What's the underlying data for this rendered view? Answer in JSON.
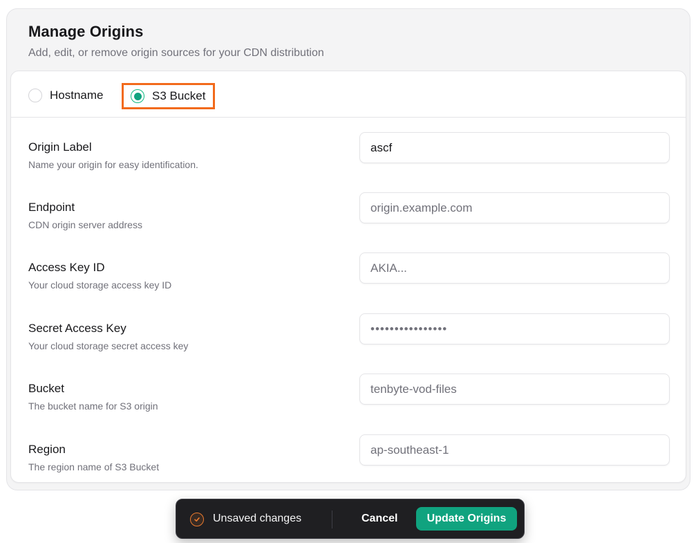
{
  "header": {
    "title": "Manage Origins",
    "subtitle": "Add, edit, or remove origin sources for your CDN distribution"
  },
  "origin_type": {
    "options": [
      {
        "label": "Hostname",
        "selected": false
      },
      {
        "label": "S3 Bucket",
        "selected": true
      }
    ]
  },
  "fields": {
    "origin_label": {
      "label": "Origin Label",
      "help": "Name your origin for easy identification.",
      "value": "ascf",
      "placeholder": ""
    },
    "endpoint": {
      "label": "Endpoint",
      "help": "CDN origin server address",
      "value": "",
      "placeholder": "origin.example.com"
    },
    "access_key_id": {
      "label": "Access Key ID",
      "help": "Your cloud storage access key ID",
      "value": "",
      "placeholder": "AKIA..."
    },
    "secret_access_key": {
      "label": "Secret Access Key",
      "help": "Your cloud storage secret access key",
      "value": "",
      "placeholder": "••••••••••••••••"
    },
    "bucket": {
      "label": "Bucket",
      "help": "The bucket name for S3 origin",
      "value": "",
      "placeholder": "tenbyte-vod-files"
    },
    "region": {
      "label": "Region",
      "help": "The region name of S3 Bucket",
      "value": "",
      "placeholder": "ap-southeast-1"
    }
  },
  "toast": {
    "icon": "warning-check-icon",
    "message": "Unsaved changes",
    "cancel_label": "Cancel",
    "update_label": "Update Origins"
  },
  "colors": {
    "accent": "#10a37f",
    "highlight": "#f26a1b",
    "toast_bg": "#1f1f22"
  }
}
